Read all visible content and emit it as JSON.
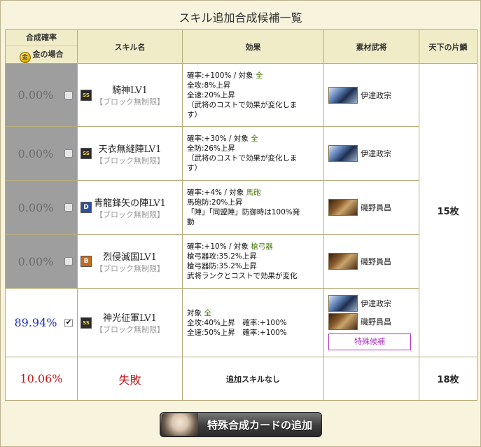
{
  "title": "スキル追加合成候補一覧",
  "headers": {
    "prob": "合成確率",
    "gold_case": "金の場合",
    "gold_coin": "金",
    "skill": "スキル名",
    "effect": "効果",
    "material": "素材武将",
    "tenka": "天下の片鱗"
  },
  "rows": [
    {
      "prob": "0.00%",
      "rank": "SS",
      "name": "騎神LV1",
      "sub": "【ブロック無制限】",
      "effect": {
        "rate": "確率:+100%",
        "target_label": "対象",
        "target": "全",
        "lines": [
          "全攻:8%上昇",
          "全速:20%上昇",
          "（武将のコストで効果が変化しま",
          "す）"
        ]
      },
      "materials": [
        {
          "name": "伊達政宗"
        }
      ]
    },
    {
      "prob": "0.00%",
      "rank": "SS",
      "name": "天衣無縫陣LV1",
      "sub": "【ブロック無制限】",
      "effect": {
        "rate": "確率:+30%",
        "target_label": "対象",
        "target": "全",
        "lines": [
          "全防:26%上昇",
          "（武将のコストで効果が変化しま",
          "す）"
        ]
      },
      "materials": [
        {
          "name": "伊達政宗"
        }
      ]
    },
    {
      "prob": "0.00%",
      "rank": "D",
      "name": "青龍鋒矢の陣LV1",
      "sub": "【ブロック無制限】",
      "effect": {
        "rate": "確率:+4%",
        "target_label": "対象",
        "target": "馬砲",
        "lines": [
          "馬砲防:20%上昇",
          "「陣」「同盟陣」防御時は100%発",
          "動"
        ]
      },
      "materials": [
        {
          "name": "磯野員昌"
        }
      ]
    },
    {
      "prob": "0.00%",
      "rank": "B",
      "name": "烈侵滅国LV1",
      "sub": "【ブロック無制限】",
      "effect": {
        "rate": "確率:+10%",
        "target_label": "対象",
        "target": "槍弓器",
        "lines": [
          "槍弓器攻:35.2%上昇",
          "槍弓器防:35.2%上昇",
          "武将ランクとコストで効果が変化"
        ]
      },
      "materials": [
        {
          "name": "磯野員昌"
        }
      ]
    },
    {
      "prob": "89.94%",
      "rank": "SS",
      "name": "神光征軍LV1",
      "sub": "【ブロック無制限】",
      "effect": {
        "target_label": "対象",
        "target": "全",
        "lines": [
          "全攻:40%上昇　確率:+100%",
          "全速:50%上昇　確率:+100%"
        ]
      },
      "materials": [
        {
          "name": "伊達政宗"
        },
        {
          "name": "磯野員昌"
        }
      ],
      "special_button": "特殊候補"
    }
  ],
  "tenka_main": "15枚",
  "fail_row": {
    "prob": "10.06%",
    "label": "失敗",
    "effect": "追加スキルなし",
    "tenka": "18枚"
  },
  "add_button": "特殊合成カードの追加"
}
